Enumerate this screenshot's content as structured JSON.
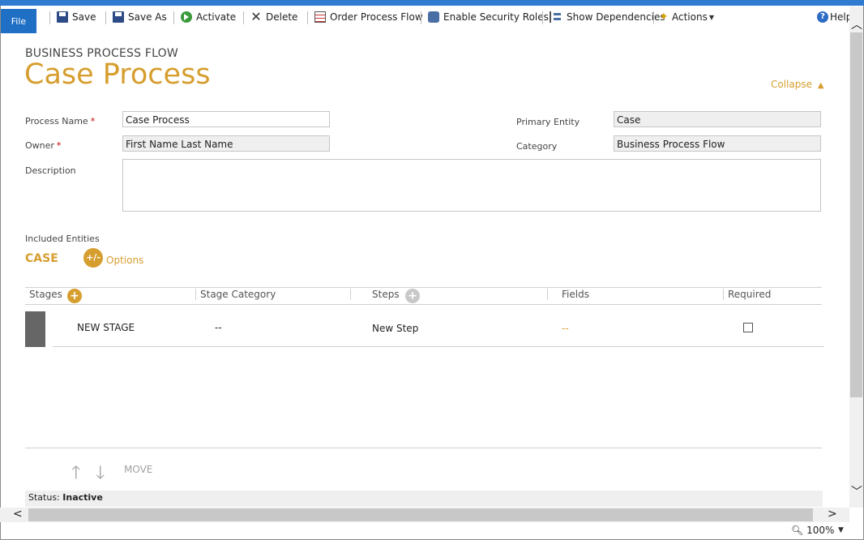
{
  "toolbar": {
    "file": "File",
    "save": "Save",
    "save_as": "Save As",
    "activate": "Activate",
    "delete": "Delete",
    "order_process_flow": "Order Process Flow",
    "enable_security_roles": "Enable Security Roles",
    "show_dependencies": "Show Dependencies",
    "actions": "Actions",
    "help": "Help"
  },
  "header": {
    "entity_label": "BUSINESS PROCESS FLOW",
    "title": "Case Process",
    "collapse": "Collapse"
  },
  "form": {
    "process_name_label": "Process Name",
    "process_name_value": "Case Process",
    "owner_label": "Owner",
    "owner_value": "First Name Last Name",
    "description_label": "Description",
    "primary_entity_label": "Primary Entity",
    "primary_entity_value": "Case",
    "category_label": "Category",
    "category_value": "Business Process Flow",
    "required_mark": "*"
  },
  "entities": {
    "label": "Included Entities",
    "entity": "CASE",
    "options_icon": "+/-",
    "options_label": "Options"
  },
  "grid": {
    "columns": [
      "Stages",
      "Stage Category",
      "Steps",
      "Fields",
      "Required"
    ],
    "rows": [
      {
        "stage": "NEW STAGE",
        "category": "--",
        "steps": "New Step",
        "fields": "--",
        "required": false
      }
    ],
    "plus": "+"
  },
  "move": {
    "up": "🡑",
    "down": "🡓",
    "label": "MOVE"
  },
  "status": {
    "label": "Status:",
    "value": "Inactive"
  },
  "zoom": {
    "level": "100%"
  }
}
